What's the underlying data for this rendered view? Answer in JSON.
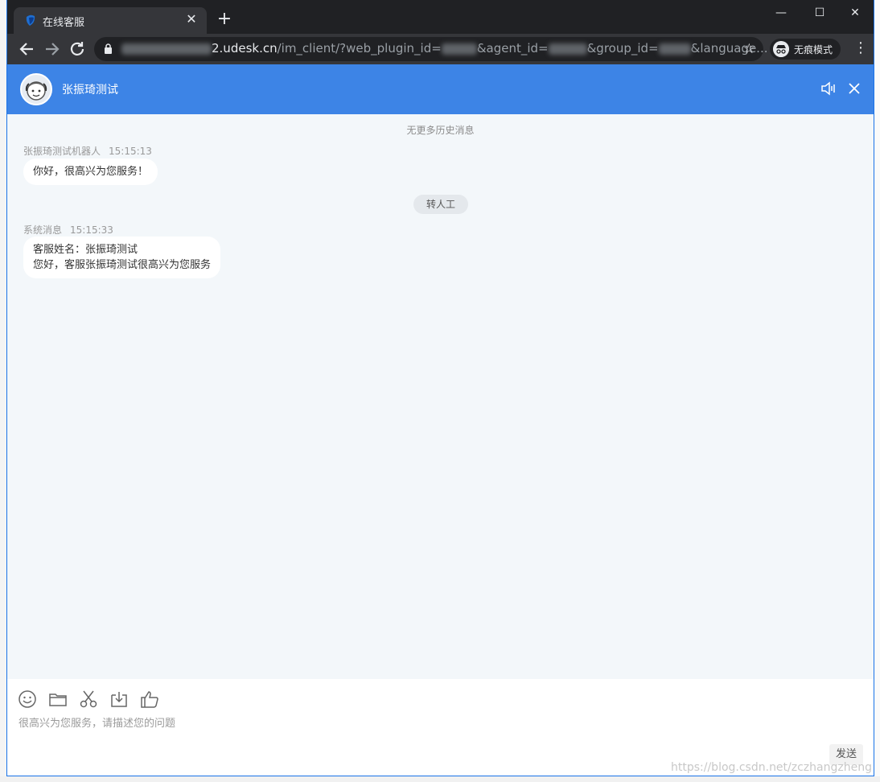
{
  "browser": {
    "tab_title": "在线客服",
    "url": {
      "host_tail": "2.udesk.cn",
      "path_part1": "/im_client/?web_plugin_id=",
      "path_part2": "&agent_id=",
      "path_part3": "&group_id=",
      "path_part4": "&language..."
    },
    "incognito_label": "无痕模式"
  },
  "chat": {
    "agent_name": "张振琦测试",
    "no_more_history": "无更多历史消息",
    "messages": [
      {
        "sender": "张振琦测试机器人",
        "time": "15:15:13",
        "lines": [
          "你好，很高兴为您服务！"
        ]
      },
      {
        "sender": "系统消息",
        "time": "15:15:33",
        "lines": [
          "客服姓名：张振琦测试",
          "您好，客服张振琦测试很高兴为您服务"
        ]
      }
    ],
    "transfer_label": "转人工",
    "composer": {
      "placeholder": "很高兴为您服务，请描述您的问题",
      "send_label": "发送",
      "tools": [
        "smile-icon",
        "folder-icon",
        "scissors-icon",
        "download-icon",
        "thumbs-up-icon"
      ]
    }
  },
  "watermark": "https://blog.csdn.net/zczhangzheng",
  "colors": {
    "header": "#3d84e6",
    "chat_bg": "#f3f7fa",
    "titlebar": "#202124"
  }
}
